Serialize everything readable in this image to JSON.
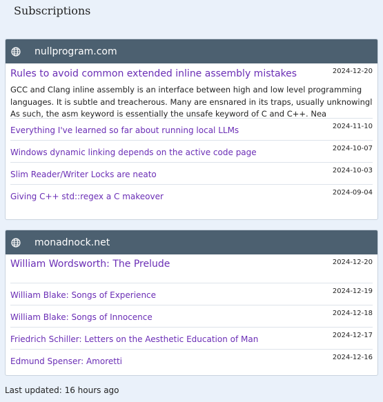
{
  "page": {
    "title": "Subscriptions"
  },
  "feeds": [
    {
      "name": "nullprogram.com",
      "icon": "globe-icon",
      "items": [
        {
          "title": "Rules to avoid common extended inline assembly mistakes",
          "date": "2024-12-20",
          "summary_lines": [
            "GCC and Clang inline assembly is an interface between high and low level programming",
            "languages. It is subtle and treacherous. Many are ensnared in its traps, usually unknowingly.",
            "As such, the asm keyword is essentially the unsafe keyword of C and C++. Nea"
          ]
        },
        {
          "title": "Everything I've learned so far about running local LLMs",
          "date": "2024-11-10"
        },
        {
          "title": "Windows dynamic linking depends on the active code page",
          "date": "2024-10-07"
        },
        {
          "title": "Slim Reader/Writer Locks are neato",
          "date": "2024-10-03"
        },
        {
          "title": "Giving C++ std::regex a C makeover",
          "date": "2024-09-04"
        }
      ]
    },
    {
      "name": "monadnock.net",
      "icon": "globe-icon",
      "items": [
        {
          "title": "William Wordsworth: The Prelude",
          "date": "2024-12-20"
        },
        {
          "title": "William Blake: Songs of Experience",
          "date": "2024-12-19"
        },
        {
          "title": "William Blake: Songs of Innocence",
          "date": "2024-12-18"
        },
        {
          "title": "Friedrich Schiller: Letters on the Aesthetic Education of Man",
          "date": "2024-12-17"
        },
        {
          "title": "Edmund Spenser: Amoretti",
          "date": "2024-12-16"
        }
      ]
    }
  ],
  "footer": {
    "last_updated": "Last updated: 16 hours ago"
  },
  "colors": {
    "header_bg": "#4c6070",
    "link": "#6a2db5",
    "page_bg": "#eaf1fa"
  }
}
